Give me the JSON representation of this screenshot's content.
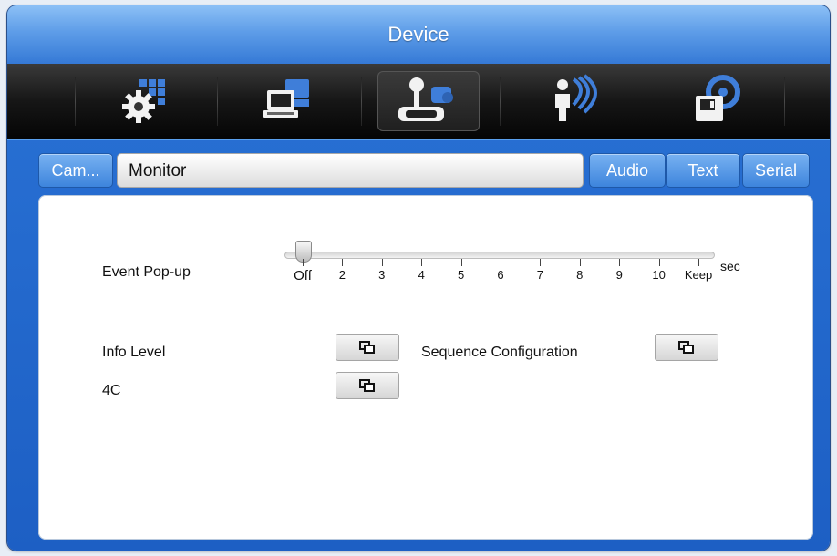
{
  "window": {
    "title": "Device"
  },
  "toolbar": {
    "icons": [
      {
        "name": "camera-grid-gear-icon"
      },
      {
        "name": "network-computers-icon"
      },
      {
        "name": "joystick-device-icon",
        "active": true
      },
      {
        "name": "person-signal-icon"
      },
      {
        "name": "storage-disk-icon"
      }
    ]
  },
  "subtabs": {
    "camera": "Cam...",
    "selected": "Monitor",
    "audio": "Audio",
    "text": "Text",
    "serial": "Serial"
  },
  "event_popup": {
    "label": "Event Pop-up",
    "unit": "sec",
    "ticks": [
      "Off",
      "2",
      "3",
      "4",
      "5",
      "6",
      "7",
      "8",
      "9",
      "10",
      "Keep"
    ],
    "value": "Off"
  },
  "settings": {
    "info_level": "Info Level",
    "sequence_configuration": "Sequence Configuration",
    "four_c": "4C"
  },
  "colors": {
    "accent": "#2a73d6",
    "icon_bar": "#111111",
    "panel": "#ffffff"
  }
}
